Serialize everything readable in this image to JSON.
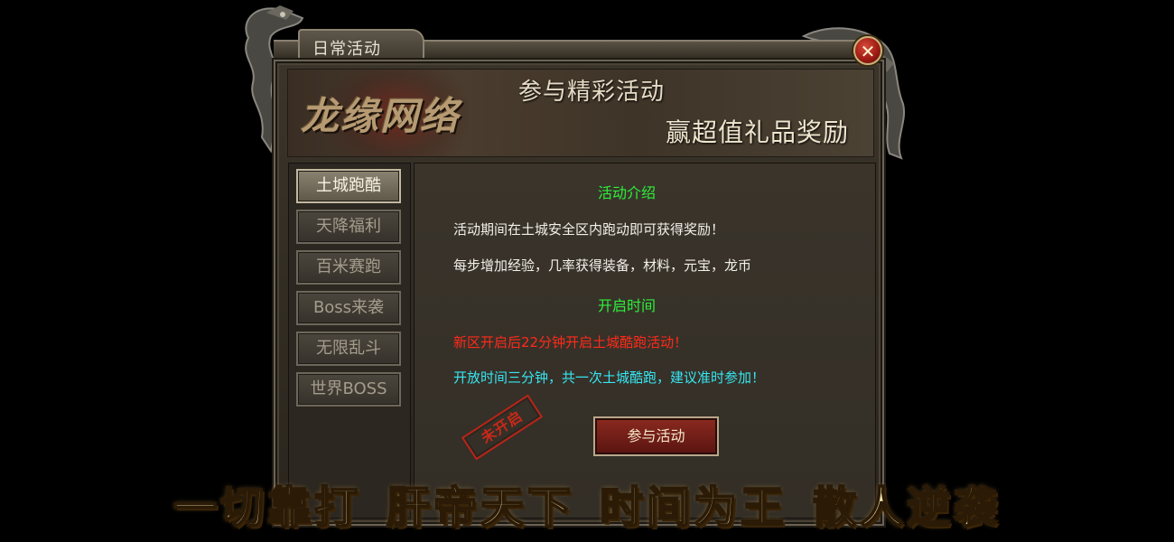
{
  "window": {
    "title": "日常活动",
    "close_icon": "close-x-icon"
  },
  "banner": {
    "logo": "龙缘网络",
    "line1": "参与精彩活动",
    "line2": "赢超值礼品奖励"
  },
  "sidebar": {
    "items": [
      {
        "label": "土城跑酷",
        "active": true
      },
      {
        "label": "天降福利",
        "active": false
      },
      {
        "label": "百米赛跑",
        "active": false
      },
      {
        "label": "Boss来袭",
        "active": false
      },
      {
        "label": "无限乱斗",
        "active": false
      },
      {
        "label": "世界BOSS",
        "active": false
      }
    ]
  },
  "content": {
    "intro_title": "活动介绍",
    "intro_line1": "活动期间在土城安全区内跑动即可获得奖励！",
    "intro_line2": "每步增加经验，几率获得装备，材料，元宝，龙币",
    "time_title": "开启时间",
    "time_line1": "新区开启后22分钟开启土城酷跑活动！",
    "time_line2": "开放时间三分钟，共一次土城酷跑，建议准时参加！",
    "join_button": "参与活动",
    "status_stamp": "未开启"
  },
  "slogan": {
    "parts": [
      "一切靠打",
      "肝帝天下",
      "时间为王",
      "散人逆袭"
    ]
  },
  "colors": {
    "section_title": "#2ef03a",
    "highlight_red": "#ff2a1a",
    "highlight_cyan": "#36e6f2",
    "slogan_gold": "#f6e7b0"
  }
}
